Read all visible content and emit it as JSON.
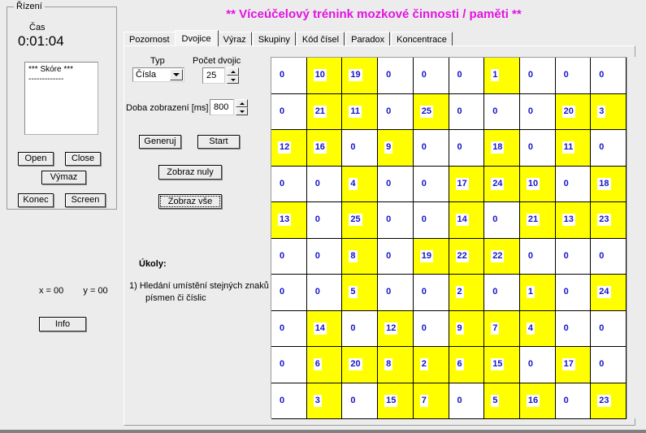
{
  "app": {
    "title": "** Víceúčelový trénink mozkové činnosti / paměti **",
    "title_color": "#e313e3"
  },
  "control_panel": {
    "group_title": "Řízení",
    "time_label": "Čas",
    "time_value": "0:01:04",
    "score_lines": [
      "*** Skóre ***",
      "-------------"
    ],
    "buttons": {
      "open": "Open",
      "close": "Close",
      "vymaz": "Výmaz",
      "konec": "Konec",
      "screen": "Screen",
      "info": "Info"
    },
    "coords": {
      "x_label": "x = 00",
      "y_label": "y = 00"
    }
  },
  "tabs": [
    {
      "label": "Pozornost",
      "active": false
    },
    {
      "label": "Dvojice",
      "active": true
    },
    {
      "label": "Výraz",
      "active": false
    },
    {
      "label": "Skupiny",
      "active": false
    },
    {
      "label": "Kód čísel",
      "active": false
    },
    {
      "label": "Paradox",
      "active": false
    },
    {
      "label": "Koncentrace",
      "active": false
    }
  ],
  "settings": {
    "typ_label": "Typ",
    "typ_value": "Čísla",
    "pocet_label": "Počet dvojic",
    "pocet_value": "25",
    "doba_label": "Doba zobrazení [ms]",
    "doba_value": "800",
    "btn_generuj": "Generuj",
    "btn_start": "Start",
    "btn_zobraz_nuly": "Zobraz nuly",
    "btn_zobraz_vse": "Zobraz vše"
  },
  "tasks": {
    "heading": "Úkoly:",
    "line1": "1) Hledání umístění stejných znaků —",
    "line2": "písmen či číslic"
  },
  "grid": {
    "rows": 10,
    "cols": 10,
    "highlight_color": "#ffff00",
    "number_color": "#1515c8",
    "cells": [
      [
        {
          "v": "0",
          "h": false
        },
        {
          "v": "10",
          "h": true
        },
        {
          "v": "19",
          "h": true
        },
        {
          "v": "0",
          "h": false
        },
        {
          "v": "0",
          "h": false
        },
        {
          "v": "0",
          "h": false
        },
        {
          "v": "1",
          "h": true
        },
        {
          "v": "0",
          "h": false
        },
        {
          "v": "0",
          "h": false
        },
        {
          "v": "0",
          "h": false
        }
      ],
      [
        {
          "v": "0",
          "h": false
        },
        {
          "v": "21",
          "h": true
        },
        {
          "v": "11",
          "h": true
        },
        {
          "v": "0",
          "h": false
        },
        {
          "v": "25",
          "h": true
        },
        {
          "v": "0",
          "h": false
        },
        {
          "v": "0",
          "h": false
        },
        {
          "v": "0",
          "h": false
        },
        {
          "v": "20",
          "h": true
        },
        {
          "v": "3",
          "h": true
        }
      ],
      [
        {
          "v": "12",
          "h": true
        },
        {
          "v": "16",
          "h": true
        },
        {
          "v": "0",
          "h": false
        },
        {
          "v": "9",
          "h": true
        },
        {
          "v": "0",
          "h": false
        },
        {
          "v": "0",
          "h": false
        },
        {
          "v": "18",
          "h": true
        },
        {
          "v": "0",
          "h": false
        },
        {
          "v": "11",
          "h": true
        },
        {
          "v": "0",
          "h": false
        }
      ],
      [
        {
          "v": "0",
          "h": false
        },
        {
          "v": "0",
          "h": false
        },
        {
          "v": "4",
          "h": true
        },
        {
          "v": "0",
          "h": false
        },
        {
          "v": "0",
          "h": false
        },
        {
          "v": "17",
          "h": true
        },
        {
          "v": "24",
          "h": true
        },
        {
          "v": "10",
          "h": true
        },
        {
          "v": "0",
          "h": false
        },
        {
          "v": "18",
          "h": true
        }
      ],
      [
        {
          "v": "13",
          "h": true
        },
        {
          "v": "0",
          "h": false
        },
        {
          "v": "25",
          "h": true
        },
        {
          "v": "0",
          "h": false
        },
        {
          "v": "0",
          "h": false
        },
        {
          "v": "14",
          "h": true
        },
        {
          "v": "0",
          "h": false
        },
        {
          "v": "21",
          "h": true
        },
        {
          "v": "13",
          "h": true
        },
        {
          "v": "23",
          "h": true
        }
      ],
      [
        {
          "v": "0",
          "h": false
        },
        {
          "v": "0",
          "h": false
        },
        {
          "v": "8",
          "h": true
        },
        {
          "v": "0",
          "h": false
        },
        {
          "v": "19",
          "h": true
        },
        {
          "v": "22",
          "h": true
        },
        {
          "v": "22",
          "h": true
        },
        {
          "v": "0",
          "h": false
        },
        {
          "v": "0",
          "h": false
        },
        {
          "v": "0",
          "h": false
        }
      ],
      [
        {
          "v": "0",
          "h": false
        },
        {
          "v": "0",
          "h": false
        },
        {
          "v": "5",
          "h": true
        },
        {
          "v": "0",
          "h": false
        },
        {
          "v": "0",
          "h": false
        },
        {
          "v": "2",
          "h": true
        },
        {
          "v": "0",
          "h": false
        },
        {
          "v": "1",
          "h": true
        },
        {
          "v": "0",
          "h": false
        },
        {
          "v": "24",
          "h": true
        }
      ],
      [
        {
          "v": "0",
          "h": false
        },
        {
          "v": "14",
          "h": true
        },
        {
          "v": "0",
          "h": false
        },
        {
          "v": "12",
          "h": true
        },
        {
          "v": "0",
          "h": false
        },
        {
          "v": "9",
          "h": true
        },
        {
          "v": "7",
          "h": true
        },
        {
          "v": "4",
          "h": true
        },
        {
          "v": "0",
          "h": false
        },
        {
          "v": "0",
          "h": false
        }
      ],
      [
        {
          "v": "0",
          "h": false
        },
        {
          "v": "6",
          "h": true
        },
        {
          "v": "20",
          "h": true
        },
        {
          "v": "8",
          "h": true
        },
        {
          "v": "2",
          "h": true
        },
        {
          "v": "6",
          "h": true
        },
        {
          "v": "15",
          "h": true
        },
        {
          "v": "0",
          "h": false
        },
        {
          "v": "17",
          "h": true
        },
        {
          "v": "0",
          "h": false
        }
      ],
      [
        {
          "v": "0",
          "h": false
        },
        {
          "v": "3",
          "h": true
        },
        {
          "v": "0",
          "h": false
        },
        {
          "v": "15",
          "h": true
        },
        {
          "v": "7",
          "h": true
        },
        {
          "v": "0",
          "h": false
        },
        {
          "v": "5",
          "h": true
        },
        {
          "v": "16",
          "h": true
        },
        {
          "v": "0",
          "h": false
        },
        {
          "v": "23",
          "h": true
        }
      ]
    ]
  }
}
